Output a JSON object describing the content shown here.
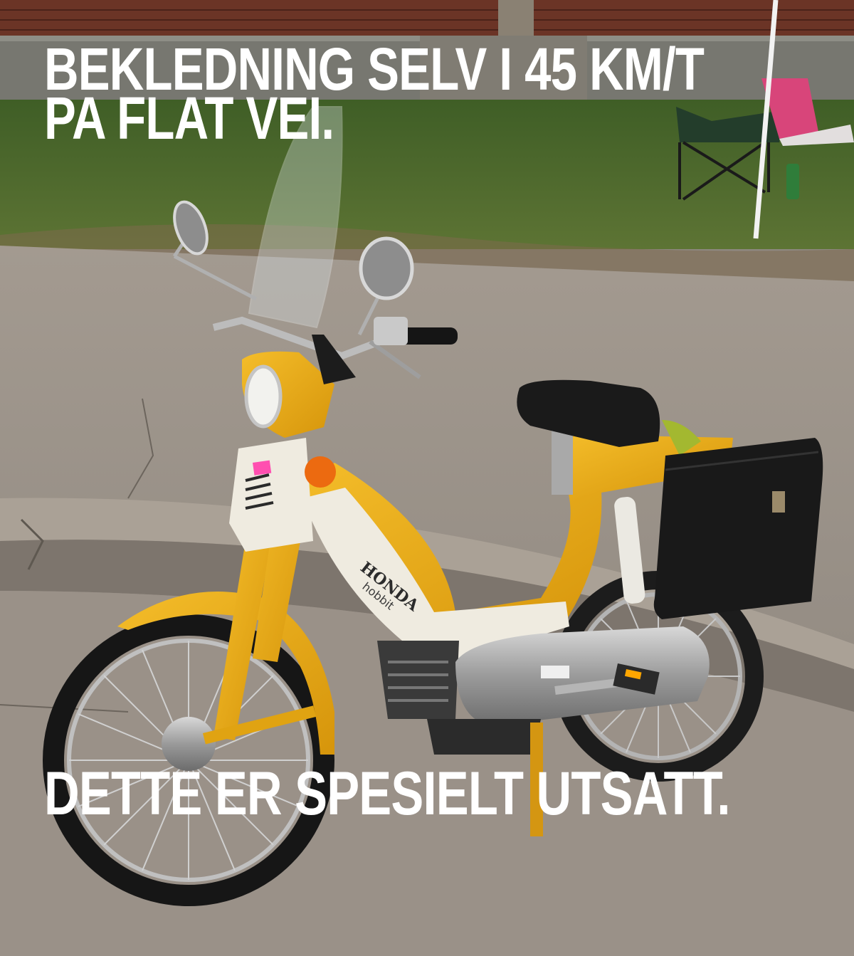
{
  "meme": {
    "top_lines": [
      "BEKLEDNING SELV I 45 KM/T",
      "PA FLAT VEI."
    ],
    "bottom_line": "DETTE ER SPESIELT UTSATT."
  },
  "photo": {
    "moped_brand_text": "HONDA",
    "moped_model_text": "hobbit",
    "colors": {
      "body_yellow": "#e8a912",
      "panel_white": "#efebe0",
      "pavement": "#948c84",
      "grass": "#4a6a2c",
      "brick": "#6b3426",
      "caption_text": "#ffffff"
    }
  }
}
